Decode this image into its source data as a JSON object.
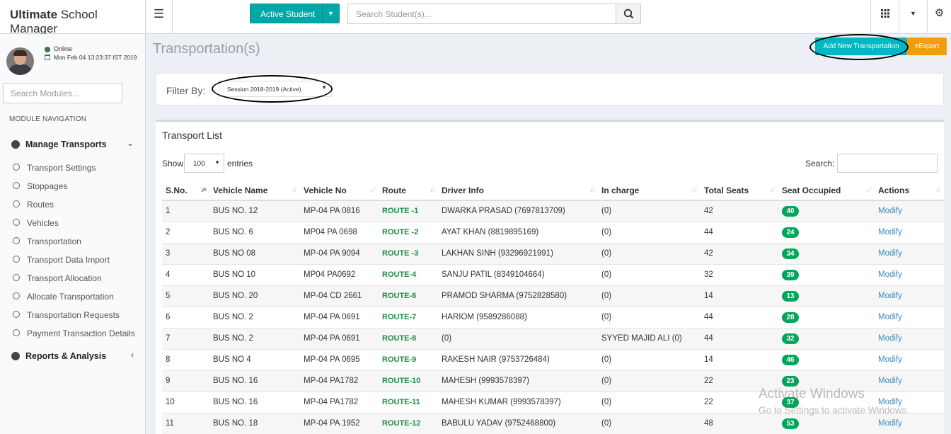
{
  "header": {
    "brand_bold": "Ultimate",
    "brand_rest": "School Manager",
    "active_student_label": "Active Student",
    "search_placeholder": "Search Student(s)..."
  },
  "sidebar": {
    "status": "Online",
    "datetime": "Mon Feb 04 13:23:37 IST 2019",
    "module_search_placeholder": "Search Modules...",
    "nav_header": "MODULE NAVIGATION",
    "groups": [
      {
        "label": "Manage Transports",
        "items": [
          "Transport Settings",
          "Stoppages",
          "Routes",
          "Vehicles",
          "Transportation",
          "Transport Data Import",
          "Transport Allocation",
          "Allocate Transportation",
          "Transportation Requests",
          "Payment Transaction Details"
        ]
      },
      {
        "label": "Reports & Analysis"
      }
    ]
  },
  "page": {
    "title": "Transportation(s)",
    "add_button": "Add New Transportation",
    "export_button": "Export",
    "filter_label": "Filter By:",
    "session_value": "Session 2018-2019 (Active)"
  },
  "list": {
    "title": "Transport List",
    "show_label": "Show",
    "entries_value": "100",
    "entries_label": "entries",
    "search_label": "Search:",
    "columns": [
      "S.No.",
      "Vehicle Name",
      "Vehicle No",
      "Route",
      "Driver Info",
      "In charge",
      "Total Seats",
      "Seat Occupied",
      "Actions"
    ],
    "rows": [
      [
        "1",
        "BUS NO. 12",
        "MP-04 PA 0816",
        "ROUTE -1",
        "DWARKA PRASAD (7697813709)",
        "(0)",
        "42",
        "40",
        "Modify"
      ],
      [
        "2",
        "BUS NO. 6",
        "MP04 PA 0698",
        "ROUTE -2",
        "AYAT KHAN (8819895169)",
        "(0)",
        "44",
        "24",
        "Modify"
      ],
      [
        "3",
        "BUS NO 08",
        "MP-04 PA 9094",
        "ROUTE -3",
        "LAKHAN SINH (93296921991)",
        "(0)",
        "42",
        "34",
        "Modify"
      ],
      [
        "4",
        "BUS NO 10",
        "MP04 PA0692",
        "ROUTE-4",
        "SANJU PATIL (8349104664)",
        "(0)",
        "32",
        "39",
        "Modify"
      ],
      [
        "5",
        "BUS NO. 20",
        "MP-04 CD 2661",
        "ROUTE-6",
        "PRAMOD SHARMA (9752828580)",
        "(0)",
        "14",
        "13",
        "Modify"
      ],
      [
        "6",
        "BUS NO. 2",
        "MP-04 PA 0691",
        "ROUTE-7",
        "HARIOM (9589286088)",
        "(0)",
        "44",
        "28",
        "Modify"
      ],
      [
        "7",
        "BUS NO. 2",
        "MP-04 PA 0691",
        "ROUTE-8",
        "(0)",
        "SYYED MAJID ALI (0)",
        "44",
        "32",
        "Modify"
      ],
      [
        "8",
        "BUS NO 4",
        "MP-04 PA 0695",
        "ROUTE-9",
        "RAKESH NAIR (9753726484)",
        "(0)",
        "14",
        "46",
        "Modify"
      ],
      [
        "9",
        "BUS NO. 16",
        "MP-04 PA1782",
        "ROUTE-10",
        "MAHESH (9993578397)",
        "(0)",
        "22",
        "23",
        "Modify"
      ],
      [
        "10",
        "BUS NO. 16",
        "MP-04 PA1782",
        "ROUTE-11",
        "MAHESH KUMAR (9993578397)",
        "(0)",
        "22",
        "37",
        "Modify"
      ],
      [
        "11",
        "BUS NO. 18",
        "MP-04 PA 1952",
        "ROUTE-12",
        "BABULU YADAV (9752468800)",
        "(0)",
        "48",
        "53",
        "Modify"
      ]
    ]
  },
  "watermark": {
    "line1": "Activate Windows",
    "line2": "Go to Settings to activate Windows."
  },
  "colors": {
    "accent_teal": "#00a7a7",
    "export_orange": "#f39c12",
    "route_green": "#1e8c45",
    "badge_green": "#00a65a",
    "link_blue": "#3c8dbc"
  }
}
